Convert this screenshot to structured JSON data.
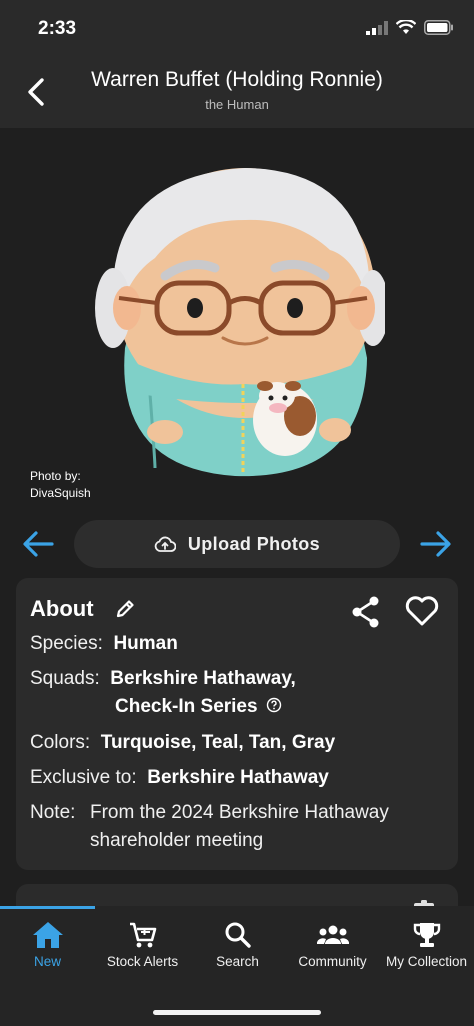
{
  "status_bar": {
    "time": "2:33"
  },
  "header": {
    "title": "Warren Buffet (Holding Ronnie)",
    "subtitle": "the Human"
  },
  "photo": {
    "credit_label": "Photo by:",
    "credit_name": "DivaSquish"
  },
  "upload_button": {
    "label": "Upload Photos"
  },
  "about": {
    "title": "About",
    "species_label": "Species:",
    "species_value": "Human",
    "squads_label": "Squads:",
    "squads_value_line1": "Berkshire Hathaway,",
    "squads_value_line2": "Check-In Series",
    "colors_label": "Colors:",
    "colors_value": "Turquoise, Teal, Tan, Gray",
    "exclusive_label": "Exclusive to:",
    "exclusive_value": "Berkshire Hathaway",
    "note_label": "Note:",
    "note_line1": "From the 2024 Berkshire Hathaway",
    "note_line2": "shareholder meeting"
  },
  "tabs": [
    {
      "label": "New",
      "icon": "home-icon",
      "active": true
    },
    {
      "label": "Stock Alerts",
      "icon": "cart-icon"
    },
    {
      "label": "Search",
      "icon": "search-icon"
    },
    {
      "label": "Community",
      "icon": "community-icon"
    },
    {
      "label": "My Collection",
      "icon": "trophy-icon"
    }
  ],
  "colors": {
    "accent": "#3ba3e6",
    "background": "#1f1f1f",
    "card": "#2b2b2b"
  }
}
